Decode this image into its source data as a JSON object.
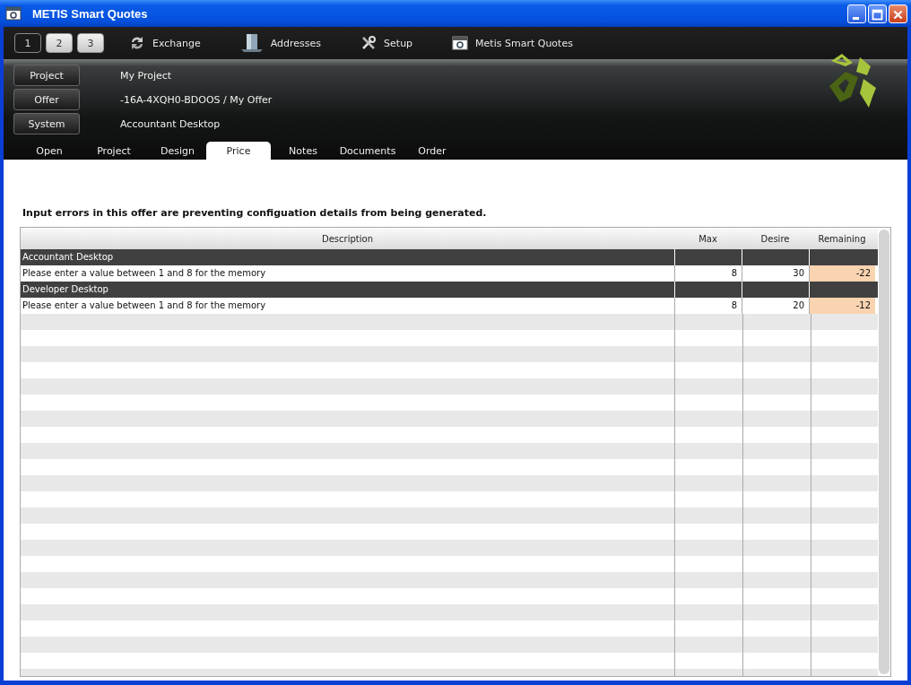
{
  "window": {
    "title": "METIS Smart Quotes"
  },
  "pages": [
    {
      "label": "1",
      "selected": true
    },
    {
      "label": "2",
      "selected": false
    },
    {
      "label": "3",
      "selected": false
    }
  ],
  "toolbar": [
    {
      "kind": "exchange",
      "label": "Exchange"
    },
    {
      "kind": "addresses",
      "label": "Addresses"
    },
    {
      "kind": "setup",
      "label": "Setup"
    },
    {
      "kind": "app",
      "label": "Metis Smart Quotes"
    }
  ],
  "context": [
    {
      "button": "Project",
      "value": "My Project"
    },
    {
      "button": "Offer",
      "value": "-16A-4XQH0-BDOOS / My Offer"
    },
    {
      "button": "System",
      "value": "Accountant Desktop"
    }
  ],
  "tabs": [
    {
      "label": "Open",
      "selected": false
    },
    {
      "label": "Project",
      "selected": false
    },
    {
      "label": "Design",
      "selected": false
    },
    {
      "label": "Price",
      "selected": true
    },
    {
      "label": "Notes",
      "selected": false
    },
    {
      "label": "Documents",
      "selected": false
    },
    {
      "label": "Order",
      "selected": false
    }
  ],
  "message": "Input errors in this offer are preventing configuation details from being generated.",
  "table": {
    "columns": [
      "Description",
      "Max",
      "Desire",
      "Remaining"
    ],
    "rows": [
      {
        "kind": "group",
        "description": "Accountant Desktop"
      },
      {
        "kind": "item",
        "description": "Please enter a value between 1 and 8 for the memory",
        "max": "8",
        "desire": "30",
        "remaining": "-22",
        "error": true
      },
      {
        "kind": "group",
        "description": "Developer Desktop"
      },
      {
        "kind": "item",
        "description": "Please enter a value between 1 and 8 for the memory",
        "max": "8",
        "desire": "20",
        "remaining": "-12",
        "error": true
      }
    ]
  }
}
